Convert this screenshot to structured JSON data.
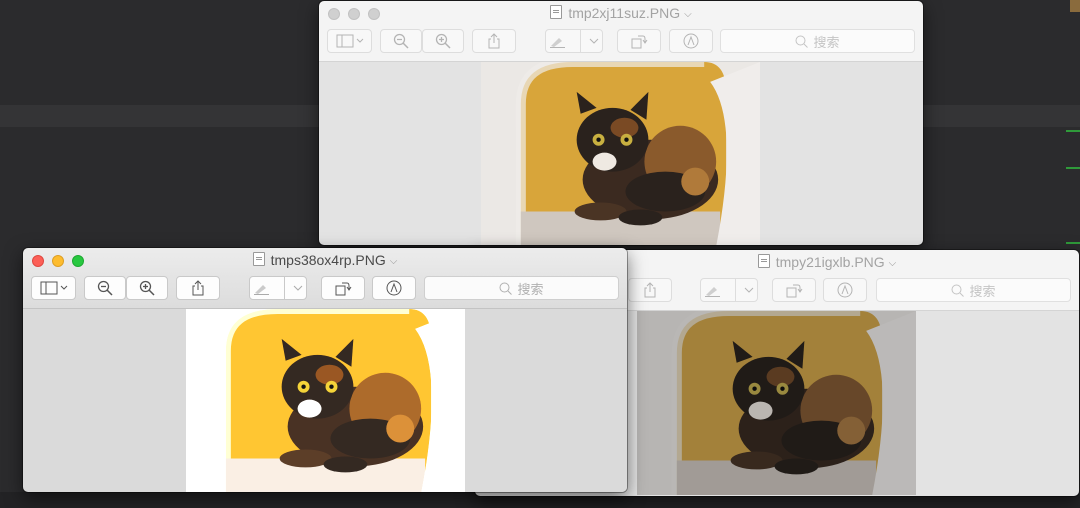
{
  "windows": [
    {
      "id": "back",
      "title": "tmp2xj11suz.PNG",
      "active": false,
      "search_placeholder": "搜索"
    },
    {
      "id": "right",
      "title": "tmpy21igxlb.PNG",
      "active": false,
      "search_placeholder": "搜索"
    },
    {
      "id": "front",
      "title": "tmps38ox4rp.PNG",
      "active": true,
      "search_placeholder": "搜索"
    }
  ],
  "photo": {
    "subject": "tortoiseshell cat in cat tree hole",
    "colors": {
      "wall": "#d8a53a",
      "fur_edge": "#ececec",
      "cat_dark": "#2a221d",
      "cat_orange": "#9a6a35",
      "eye": "#c8b040"
    }
  },
  "icons": {
    "sidebar": "sidebar-icon",
    "zoom_out": "zoom-out-icon",
    "zoom_in": "zoom-in-icon",
    "share": "share-icon",
    "highlight": "highlighter-icon",
    "rotate": "rotate-icon",
    "markup": "markup-icon",
    "search": "magnifier-icon"
  }
}
